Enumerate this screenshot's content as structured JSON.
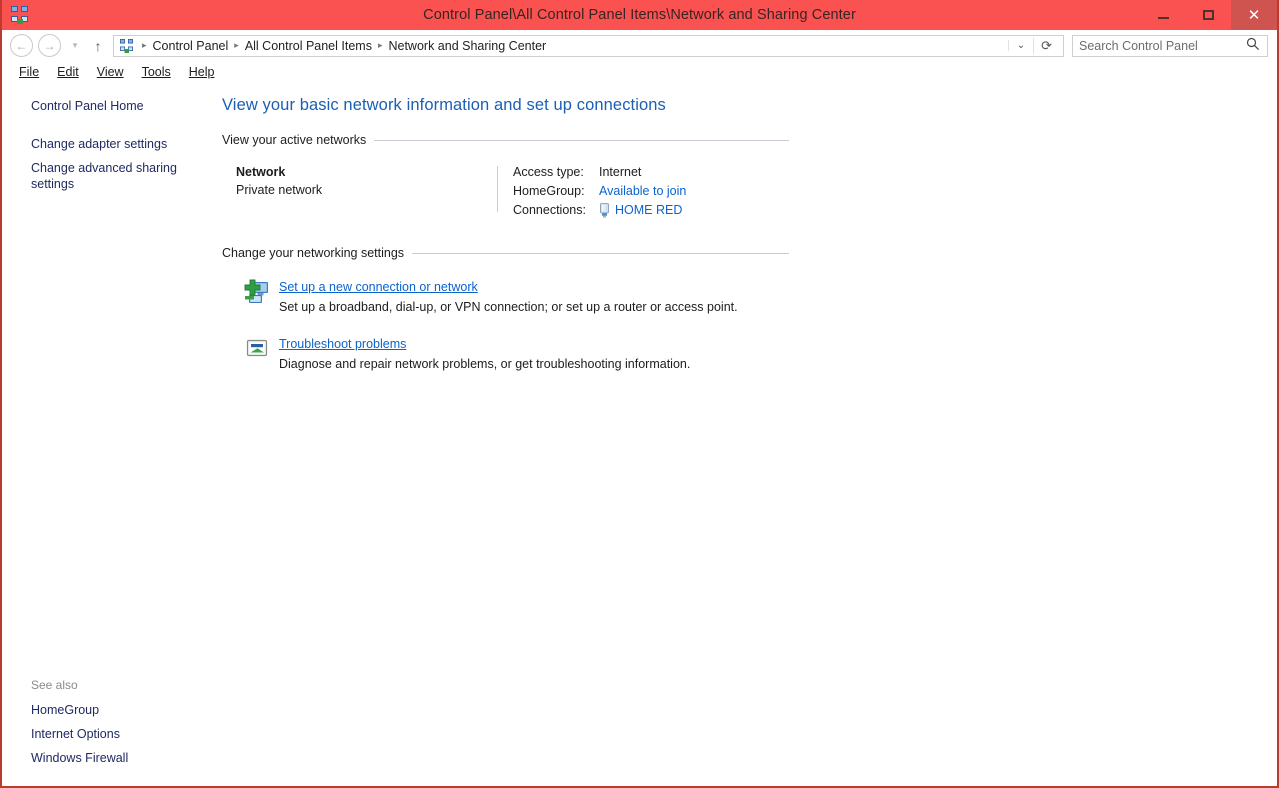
{
  "window": {
    "title": "Control Panel\\All Control Panel Items\\Network and Sharing Center",
    "app_icon": "control-panel-network-icon",
    "accent_color": "#fa5250",
    "border_color": "#c0392f",
    "controls": {
      "minimize": "–",
      "maximize": "□",
      "close": "✕"
    }
  },
  "toolbar": {
    "back": "←",
    "forward": "→",
    "recent": "▾",
    "up": "↑",
    "breadcrumb": [
      "Control Panel",
      "All Control Panel Items",
      "Network and Sharing Center"
    ],
    "breadcrumb_separator": "▸",
    "dropdown": "⌄",
    "refresh": "⟳"
  },
  "search": {
    "placeholder": "Search Control Panel",
    "value": "",
    "icon": "search-icon"
  },
  "menubar": {
    "items": [
      "File",
      "Edit",
      "View",
      "Tools",
      "Help"
    ]
  },
  "sidebar": {
    "items": [
      {
        "label": "Control Panel Home"
      },
      {
        "label": "Change adapter settings"
      },
      {
        "label": "Change advanced sharing settings"
      }
    ],
    "see_also": {
      "title": "See also",
      "items": [
        {
          "label": "HomeGroup"
        },
        {
          "label": "Internet Options"
        },
        {
          "label": "Windows Firewall"
        }
      ]
    }
  },
  "main": {
    "page_title": "View your basic network information and set up connections",
    "sections": {
      "active_networks": {
        "heading": "View your active networks",
        "network": {
          "name": "Network",
          "type": "Private network",
          "details": [
            {
              "label": "Access type:",
              "value": "Internet",
              "is_link": false,
              "icon": null
            },
            {
              "label": "HomeGroup:",
              "value": "Available to join",
              "is_link": true,
              "icon": null
            },
            {
              "label": "Connections:",
              "value": "HOME RED",
              "is_link": true,
              "icon": "network-adapter-icon"
            }
          ]
        }
      },
      "networking_settings": {
        "heading": "Change your networking settings",
        "items": [
          {
            "icon": "new-connection-icon",
            "link": "Set up a new connection or network",
            "description": "Set up a broadband, dial-up, or VPN connection; or set up a router or access point."
          },
          {
            "icon": "troubleshoot-icon",
            "link": "Troubleshoot problems",
            "description": "Diagnose and repair network problems, or get troubleshooting information."
          }
        ]
      }
    }
  },
  "colors": {
    "link": "#0b63ce",
    "sidebar_link": "#1f2a63",
    "title_heading": "#1a5fb4",
    "rule": "#c8cdd3"
  }
}
